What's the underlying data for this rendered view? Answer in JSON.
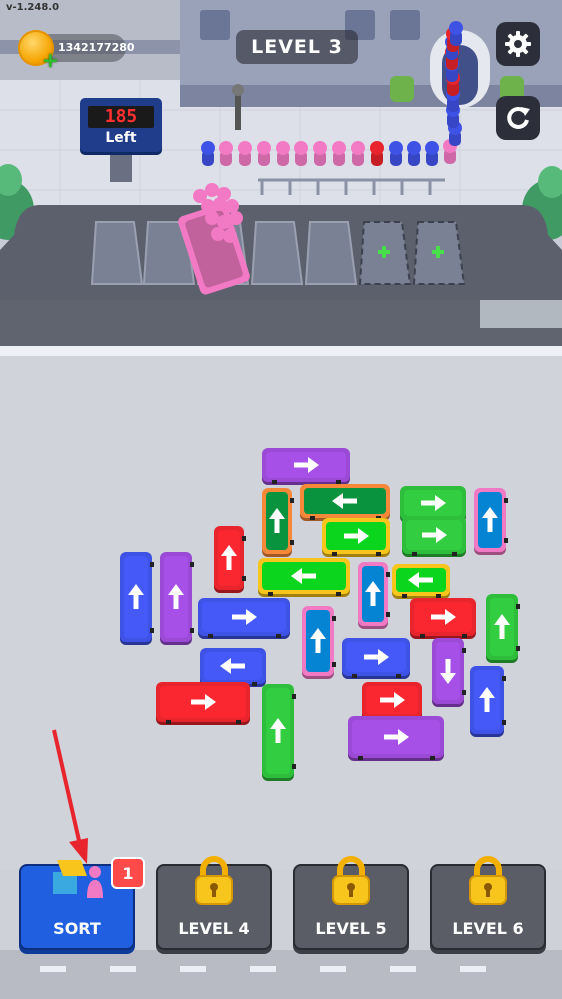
{
  "version": "v-1.248.0",
  "hud": {
    "coins": "1342177280",
    "level_title": "LEVEL 3",
    "settings_icon": "gear-icon",
    "restart_icon": "restart-icon",
    "coin_icon": "coin-icon",
    "add_coins_icon": "plus-icon"
  },
  "sign": {
    "count": "185",
    "label": "Left"
  },
  "queue": {
    "colors": [
      "blue",
      "pink",
      "pink",
      "pink",
      "pink",
      "pink",
      "pink",
      "pink",
      "pink",
      "red",
      "blue",
      "blue",
      "blue",
      "pink",
      "blue",
      "blue",
      "blue",
      "red",
      "blue",
      "red",
      "blue",
      "red",
      "blue"
    ]
  },
  "parking": {
    "slots": 7,
    "occupied_color": "pink",
    "locked_slots_icon": "plus-icon"
  },
  "colors": {
    "purple": "#9b4ad6",
    "orange": "#f6883a",
    "green": "#2ebe3c",
    "pink": "#f27ac4",
    "red": "#e8242c",
    "yellow": "#f7c51b",
    "blue": "#3f52e6"
  },
  "buses": [
    {
      "color": "purple",
      "dir": "right"
    },
    {
      "color": "orange",
      "dir": "left"
    },
    {
      "color": "green",
      "dir": "right"
    },
    {
      "color": "pink",
      "dir": "up"
    },
    {
      "color": "orange",
      "dir": "up"
    },
    {
      "color": "yellow",
      "dir": "right"
    },
    {
      "color": "green",
      "dir": "right"
    },
    {
      "color": "red",
      "dir": "up"
    },
    {
      "color": "yellow",
      "dir": "left"
    },
    {
      "color": "pink",
      "dir": "up"
    },
    {
      "color": "yellow",
      "dir": "left"
    },
    {
      "color": "blue",
      "dir": "up"
    },
    {
      "color": "purple",
      "dir": "up"
    },
    {
      "color": "blue",
      "dir": "right"
    },
    {
      "color": "pink",
      "dir": "up"
    },
    {
      "color": "red",
      "dir": "right"
    },
    {
      "color": "green",
      "dir": "up"
    },
    {
      "color": "blue",
      "dir": "right"
    },
    {
      "color": "blue",
      "dir": "left"
    },
    {
      "color": "purple",
      "dir": "down"
    },
    {
      "color": "red",
      "dir": "right"
    },
    {
      "color": "red",
      "dir": "right"
    },
    {
      "color": "blue",
      "dir": "up"
    },
    {
      "color": "green",
      "dir": "up"
    },
    {
      "color": "purple",
      "dir": "right"
    }
  ],
  "bottom": {
    "sort_label": "SORT",
    "sort_badge": "1",
    "level4": "LEVEL 4",
    "level5": "LEVEL 5",
    "level6": "LEVEL 6",
    "lock_icon": "padlock-icon",
    "sort_icon": "sort-icon"
  },
  "tutorial": {
    "pointer": "red-arrow-icon"
  }
}
